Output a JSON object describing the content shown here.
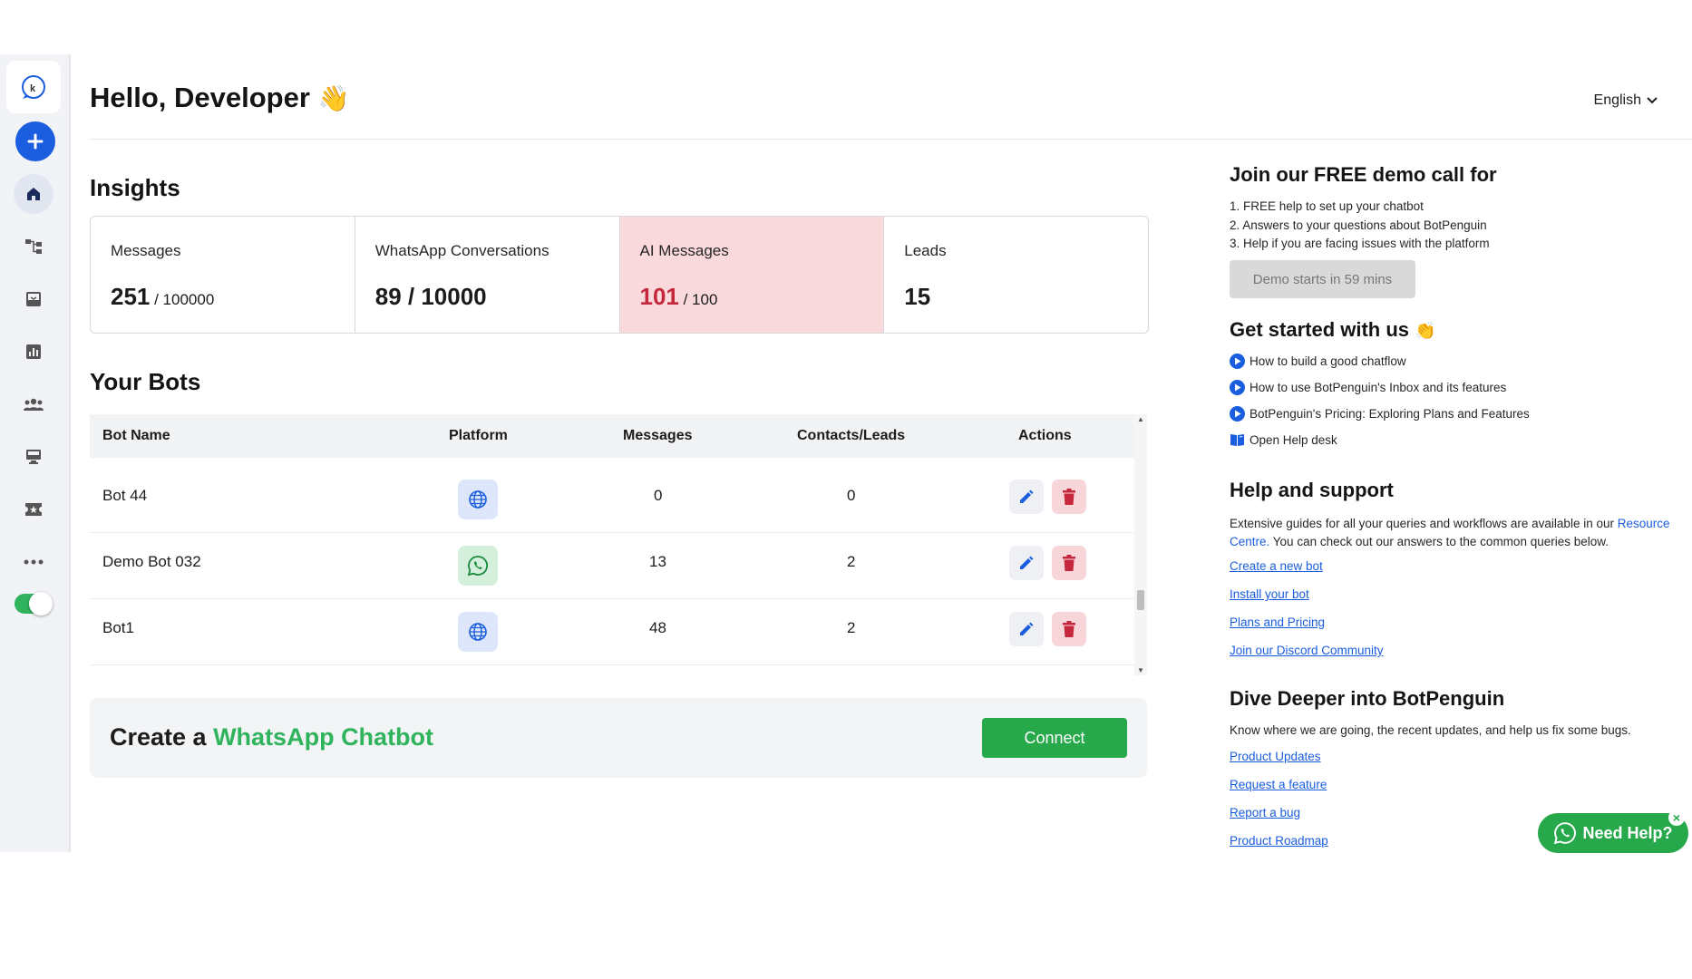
{
  "header": {
    "greeting": "Hello, Developer",
    "wave_emoji": "👋",
    "language": "English"
  },
  "insights": {
    "title": "Insights",
    "cards": [
      {
        "label": "Messages",
        "value": "251",
        "of": " / 100000"
      },
      {
        "label": "WhatsApp Conversations",
        "value": "89 / 10000",
        "of": ""
      },
      {
        "label": "AI Messages",
        "value": "101",
        "of": " / 100"
      },
      {
        "label": "Leads",
        "value": "15",
        "of": ""
      }
    ]
  },
  "bots": {
    "title": "Your Bots",
    "columns": [
      "Bot Name",
      "Platform",
      "Messages",
      "Contacts/Leads",
      "Actions"
    ],
    "rows": [
      {
        "name": "Bot 44",
        "platform": "website",
        "messages": "0",
        "contacts": "0"
      },
      {
        "name": "Demo Bot 032",
        "platform": "whatsapp",
        "messages": "13",
        "contacts": "2"
      },
      {
        "name": "Bot1",
        "platform": "website",
        "messages": "48",
        "contacts": "2"
      }
    ]
  },
  "banner": {
    "prefix": "Create a ",
    "highlight": "WhatsApp Chatbot",
    "button": "Connect"
  },
  "demo": {
    "title": "Join our FREE demo call for",
    "items": [
      "1. FREE help to set up your chatbot",
      "2. Answers to your questions about BotPenguin",
      "3. Help if you are facing issues with the platform"
    ],
    "button": "Demo starts in 59 mins"
  },
  "get_started": {
    "title": "Get started with us",
    "emoji": "👏",
    "items": [
      "How to build a good chatflow",
      "How to use BotPenguin's Inbox and its features",
      "BotPenguin's Pricing: Exploring Plans and Features"
    ],
    "helpdesk": "Open Help desk"
  },
  "support": {
    "title": "Help and support",
    "desc_1": "Extensive guides for all your queries and workflows are available in our ",
    "desc_link_1": "Resource",
    "desc_link_2": "Centre.",
    "desc_2": " You can check out our answers to the common queries below.",
    "links": [
      "Create a new bot",
      "Install your bot",
      "Plans and Pricing",
      "Join our Discord Community"
    ]
  },
  "dive": {
    "title": "Dive Deeper into BotPenguin",
    "desc": "Know where we are going, the recent updates, and help us fix some bugs.",
    "links": [
      "Product Updates",
      "Request a feature",
      "Report a bug",
      "Product Roadmap"
    ]
  },
  "need_help": {
    "label": "Need Help?",
    "close": "×"
  },
  "colors": {
    "primary": "#1a5dde",
    "green": "#27a94b",
    "alert": "#c5283d"
  },
  "icons": {
    "sidebar": [
      "logo-icon",
      "add-icon",
      "home-icon",
      "flow-icon",
      "inbox-icon",
      "analytics-icon",
      "contacts-icon",
      "billing-icon",
      "ticket-icon",
      "more-icon"
    ]
  }
}
